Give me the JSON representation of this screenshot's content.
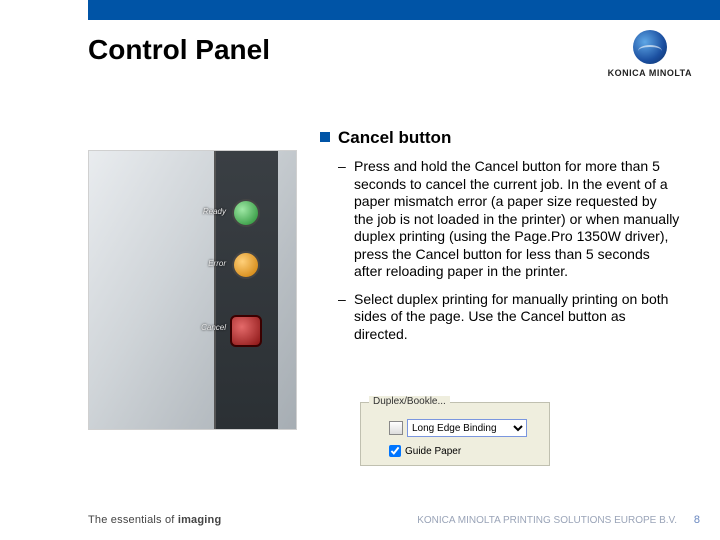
{
  "brand": {
    "name": "KONICA MINOLTA"
  },
  "title": "Control Panel",
  "photo_labels": {
    "ready": "Ready",
    "error": "Error",
    "cancel": "Cancel"
  },
  "section": {
    "heading": "Cancel button",
    "items": [
      "Press and hold the Cancel button for more than 5 seconds to cancel the current job. In the event of a paper mismatch error (a paper size requested by the job is not loaded in the printer) or when manually duplex printing (using the Page.Pro 1350W driver), press the Cancel button for less than 5 seconds after reloading paper in the printer.",
      "Select duplex printing for manually printing on both sides of the page. Use the Cancel button as directed."
    ]
  },
  "dialog": {
    "group_label": "Duplex/Bookle...",
    "combo_value": "Long Edge Binding",
    "checkbox_label": "Guide Paper",
    "checkbox_checked": true
  },
  "footer": {
    "tagline_prefix": "The essentials of ",
    "tagline_bold": "imaging",
    "company": "KONICA MINOLTA PRINTING SOLUTIONS EUROPE B.V.",
    "page": "8"
  }
}
